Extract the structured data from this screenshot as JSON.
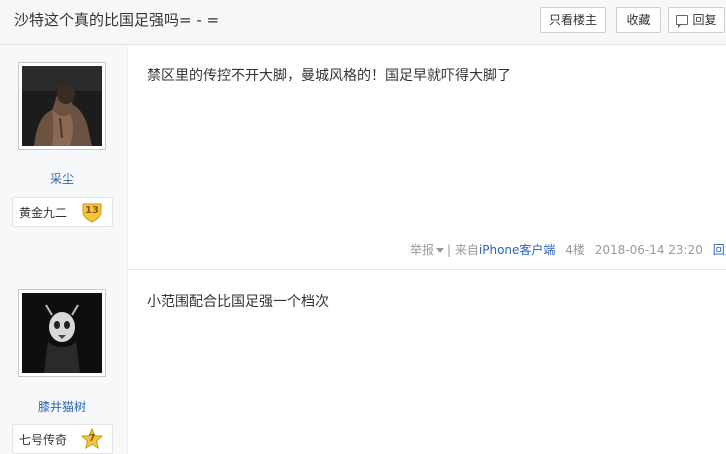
{
  "thread": {
    "title": "沙特这个真的比国足强吗= - =",
    "buttons": {
      "only_op": "只看楼主",
      "favorite": "收藏",
      "reply": "回复"
    }
  },
  "posts": [
    {
      "username": "采尘",
      "badge_title": "黄金九二",
      "badge_level": "13",
      "content": "禁区里的传控不开大脚，曼城风格的！国足早就吓得大脚了",
      "meta": {
        "report": "举报",
        "separator": "|",
        "source_prefix": "来自",
        "source_client": "iPhone客户端",
        "floor": "4楼",
        "time": "2018-06-14 23:20",
        "reply": "回复"
      }
    },
    {
      "username": "膝井猫树",
      "badge_title": "七号传奇",
      "badge_level": "7",
      "content": "小范围配合比国足强一个档次"
    }
  ],
  "colors": {
    "link": "#2d64b3",
    "sidebar_bg": "#f7f8fa",
    "meta_text": "#999999"
  }
}
